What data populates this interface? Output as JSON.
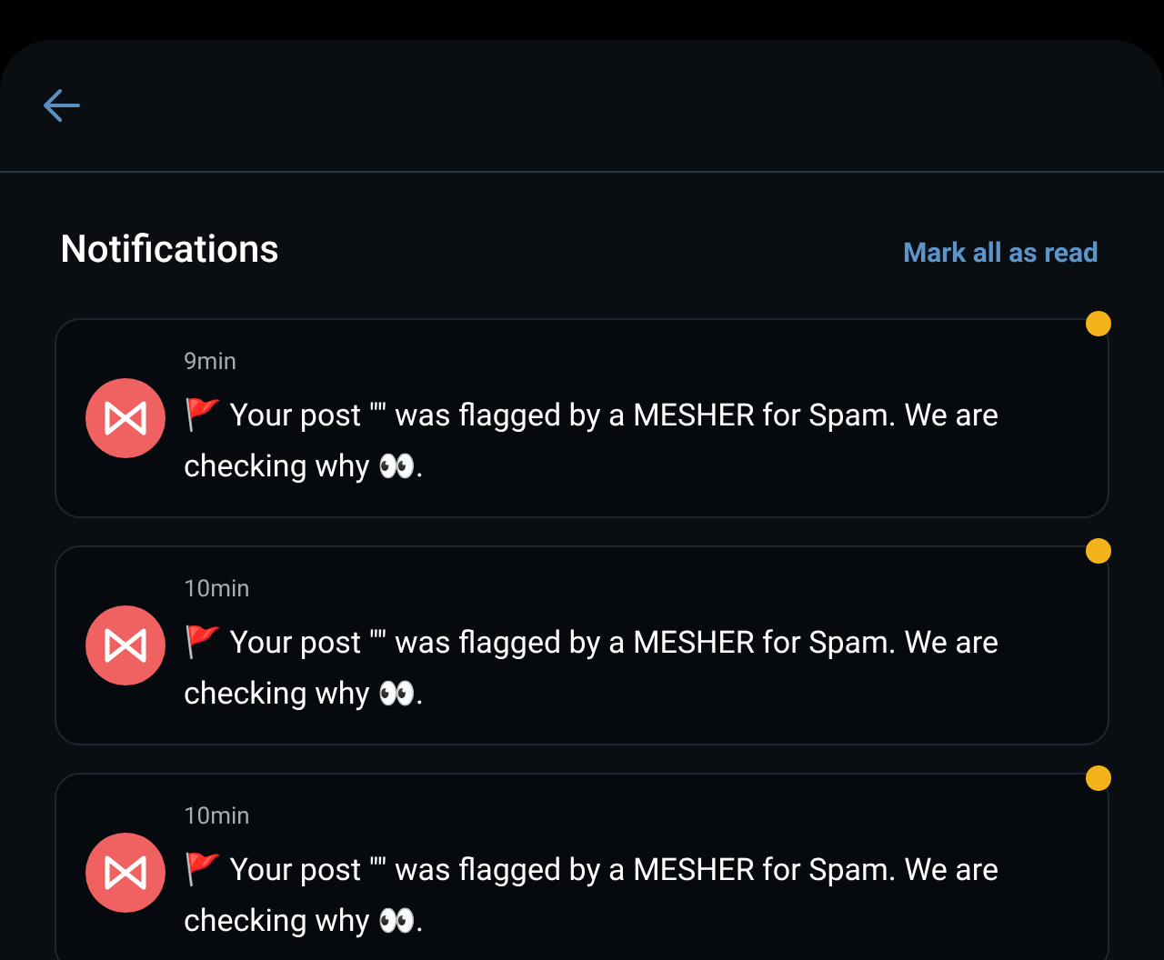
{
  "header": {
    "title": "Notifications",
    "action": "Mark all as read"
  },
  "notifications": [
    {
      "time": "9min",
      "message": "🚩 Your post \"\" was flagged by a MESHER for Spam. We are checking why 👀.",
      "unread": true
    },
    {
      "time": "10min",
      "message": "🚩 Your post \"\" was flagged by a MESHER for Spam. We are checking why 👀.",
      "unread": true
    },
    {
      "time": "10min",
      "message": "🚩 Your post \"\" was flagged by a MESHER for Spam. We are checking why 👀.",
      "unread": true
    }
  ]
}
